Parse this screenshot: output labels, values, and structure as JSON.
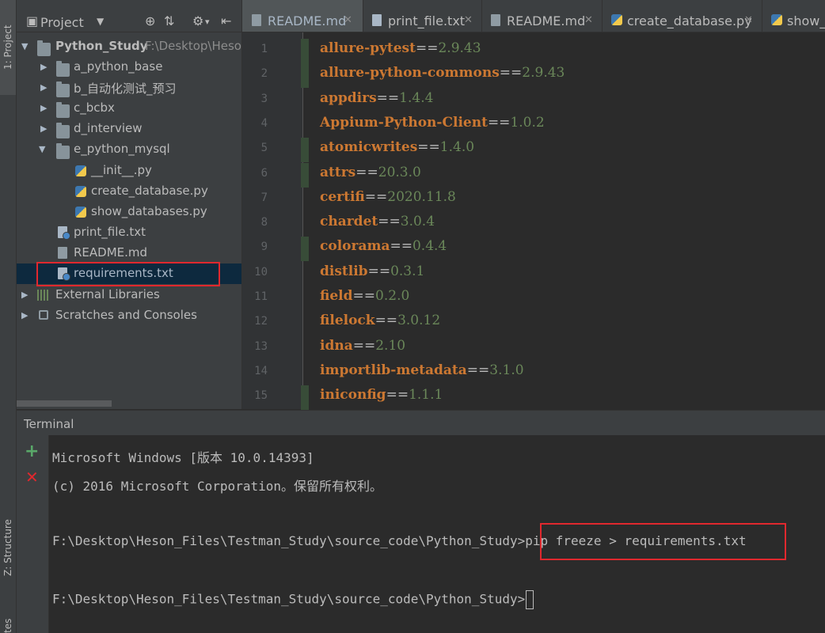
{
  "left_strip": {
    "project_tab": "1: Project",
    "structure_tab": "Z: Structure",
    "favorites_tab": "tes"
  },
  "project_panel": {
    "title": "Project",
    "root": {
      "name": "Python_Study",
      "path": "F:\\Desktop\\Heso"
    },
    "folders": [
      "a_python_base",
      "b_自动化测试_预习",
      "c_bcbx",
      "d_interview",
      "e_python_mysql"
    ],
    "subfiles": [
      "__init__.py",
      "create_database.py",
      "show_databases.py"
    ],
    "files": [
      "print_file.txt",
      "README.md",
      "requirements.txt"
    ],
    "external_libraries": "External Libraries",
    "scratches": "Scratches and Consoles",
    "highlighted": "requirements.txt"
  },
  "editor_tabs": [
    {
      "label": "README.md",
      "icon": "markdown-file-icon"
    },
    {
      "label": "print_file.txt",
      "icon": "text-file-icon"
    },
    {
      "label": "README.md",
      "icon": "markdown-file-icon"
    },
    {
      "label": "create_database.py",
      "icon": "python-file-icon"
    },
    {
      "label": "show_",
      "icon": "python-file-icon"
    }
  ],
  "editor": {
    "lines": [
      {
        "n": "1",
        "pkg": "allure-pytest",
        "op": "==",
        "ver": "2.9.43",
        "changed": true
      },
      {
        "n": "2",
        "pkg": "allure-python-commons",
        "op": "==",
        "ver": "2.9.43",
        "changed": true
      },
      {
        "n": "3",
        "pkg": "appdirs",
        "op": "==",
        "ver": "1.4.4",
        "changed": false
      },
      {
        "n": "4",
        "pkg": "Appium-Python-Client",
        "op": "==",
        "ver": "1.0.2",
        "changed": false
      },
      {
        "n": "5",
        "pkg": "atomicwrites",
        "op": "==",
        "ver": "1.4.0",
        "changed": true
      },
      {
        "n": "6",
        "pkg": "attrs",
        "op": "==",
        "ver": "20.3.0",
        "changed": true
      },
      {
        "n": "7",
        "pkg": "certifi",
        "op": "==",
        "ver": "2020.11.8",
        "changed": false
      },
      {
        "n": "8",
        "pkg": "chardet",
        "op": "==",
        "ver": "3.0.4",
        "changed": false
      },
      {
        "n": "9",
        "pkg": "colorama",
        "op": "==",
        "ver": "0.4.4",
        "changed": true
      },
      {
        "n": "10",
        "pkg": "distlib",
        "op": "==",
        "ver": "0.3.1",
        "changed": false
      },
      {
        "n": "11",
        "pkg": "field",
        "op": "==",
        "ver": "0.2.0",
        "changed": false
      },
      {
        "n": "12",
        "pkg": "filelock",
        "op": "==",
        "ver": "3.0.12",
        "changed": false
      },
      {
        "n": "13",
        "pkg": "idna",
        "op": "==",
        "ver": "2.10",
        "changed": false
      },
      {
        "n": "14",
        "pkg": "importlib-metadata",
        "op": "==",
        "ver": "3.1.0",
        "changed": false
      },
      {
        "n": "15",
        "pkg": "iniconfig",
        "op": "==",
        "ver": "1.1.1",
        "changed": true
      }
    ]
  },
  "terminal": {
    "title": "Terminal",
    "line1": "Microsoft Windows [版本 10.0.14393]",
    "line2": "(c) 2016 Microsoft Corporation。保留所有权利。",
    "prompt": "F:\\Desktop\\Heson_Files\\Testman_Study\\source_code\\Python_Study>",
    "command": "pip freeze > requirements.txt",
    "prompt2": "F:\\Desktop\\Heson_Files\\Testman_Study\\source_code\\Python_Study>"
  },
  "colors": {
    "keyword": "#cc7832",
    "number": "#6a8759",
    "highlight_box": "#e0282e",
    "selection": "#0d293e"
  }
}
